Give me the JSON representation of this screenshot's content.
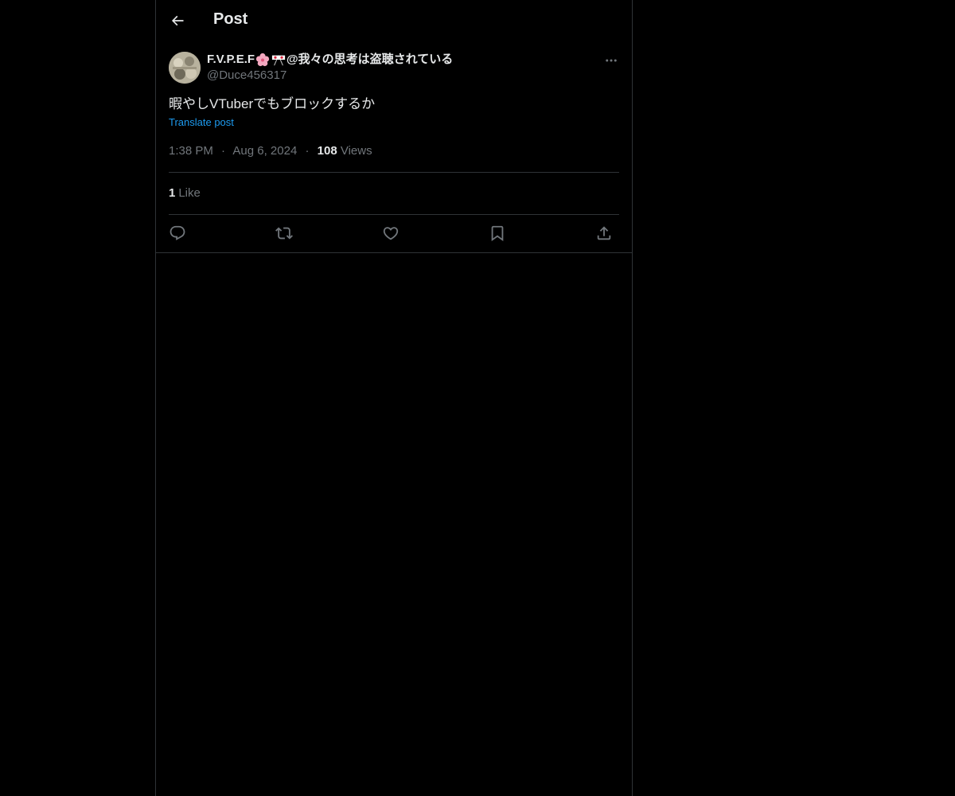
{
  "header": {
    "title": "Post"
  },
  "post": {
    "author": {
      "name_prefix": "F.V.P.E.F",
      "name_suffix": "@我々の思考は盗聴されている",
      "emojis": [
        "cherry-blossom-icon",
        "japan-flags-icon"
      ],
      "handle": "@Duce456317"
    },
    "text": "暇やしVTuberでもブロックするか",
    "translate_label": "Translate post",
    "time": "1:38 PM",
    "date": "Aug 6, 2024",
    "separator": "·",
    "views_count": "108",
    "views_label": "Views",
    "likes_count": "1",
    "likes_label": "Like"
  },
  "actions": [
    "reply-icon",
    "repost-icon",
    "like-icon",
    "bookmark-icon",
    "share-icon"
  ],
  "colors": {
    "background": "#000000",
    "text": "#e7e9ea",
    "secondary": "#71767b",
    "accent": "#1d9bf0",
    "border": "#2f3336"
  }
}
